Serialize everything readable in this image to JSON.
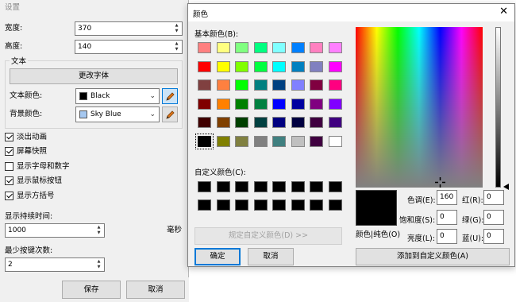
{
  "settings": {
    "title": "设置",
    "width_label": "宽度:",
    "width_value": "370",
    "height_label": "高度:",
    "height_value": "140",
    "text_group_title": "文本",
    "change_font_button": "更改字体",
    "text_color_label": "文本颜色:",
    "text_color_value": "Black",
    "text_color_hex": "#000000",
    "bg_color_label": "背景颜色:",
    "bg_color_value": "Sky Blue",
    "bg_color_hex": "#a6c8f0",
    "checkboxes": [
      {
        "label": "淡出动画",
        "checked": true
      },
      {
        "label": "屏幕快照",
        "checked": true
      },
      {
        "label": "显示字母和数字",
        "checked": false
      },
      {
        "label": "显示鼠标按钮",
        "checked": true
      },
      {
        "label": "显示方括号",
        "checked": true
      }
    ],
    "duration_label": "显示持续时间:",
    "duration_value": "1000",
    "duration_unit": "毫秒",
    "min_keys_label": "最少按键次数:",
    "min_keys_value": "2",
    "save_button": "保存",
    "cancel_button": "取消"
  },
  "color_dialog": {
    "title": "颜色",
    "close_glyph": "✕",
    "basic_colors_label": "基本颜色(B):",
    "basic_colors": [
      "#ff8080",
      "#ffff80",
      "#80ff80",
      "#00ff80",
      "#80ffff",
      "#0080ff",
      "#ff80c0",
      "#ff80ff",
      "#ff0000",
      "#ffff00",
      "#80ff00",
      "#00ff40",
      "#00ffff",
      "#0080c0",
      "#8080c0",
      "#ff00ff",
      "#804040",
      "#ff8040",
      "#00ff00",
      "#008080",
      "#004080",
      "#8080ff",
      "#800040",
      "#ff0080",
      "#800000",
      "#ff8000",
      "#008000",
      "#008040",
      "#0000ff",
      "#0000a0",
      "#800080",
      "#8000ff",
      "#400000",
      "#804000",
      "#004000",
      "#004040",
      "#000080",
      "#000040",
      "#400040",
      "#400080",
      "#000000",
      "#808000",
      "#808040",
      "#808080",
      "#408080",
      "#c0c0c0",
      "#400040",
      "#ffffff"
    ],
    "selected_basic_index": 40,
    "custom_colors_label": "自定义颜色(C):",
    "custom_colors": [
      "#000000",
      "#000000",
      "#000000",
      "#000000",
      "#000000",
      "#000000",
      "#000000",
      "#000000",
      "#000000",
      "#000000",
      "#000000",
      "#000000",
      "#000000",
      "#000000",
      "#000000",
      "#000000"
    ],
    "define_custom_button": "规定自定义颜色(D) >>",
    "ok_button": "确定",
    "cancel_button": "取消",
    "preview_label": "颜色|纯色(O)",
    "hue_label": "色调(E):",
    "hue_value": "160",
    "sat_label": "饱和度(S):",
    "sat_value": "0",
    "lum_label": "亮度(L):",
    "lum_value": "0",
    "red_label": "红(R):",
    "red_value": "0",
    "green_label": "绿(G):",
    "green_value": "0",
    "blue_label": "蓝(U):",
    "blue_value": "0",
    "add_custom_button": "添加到自定义颜色(A)"
  }
}
